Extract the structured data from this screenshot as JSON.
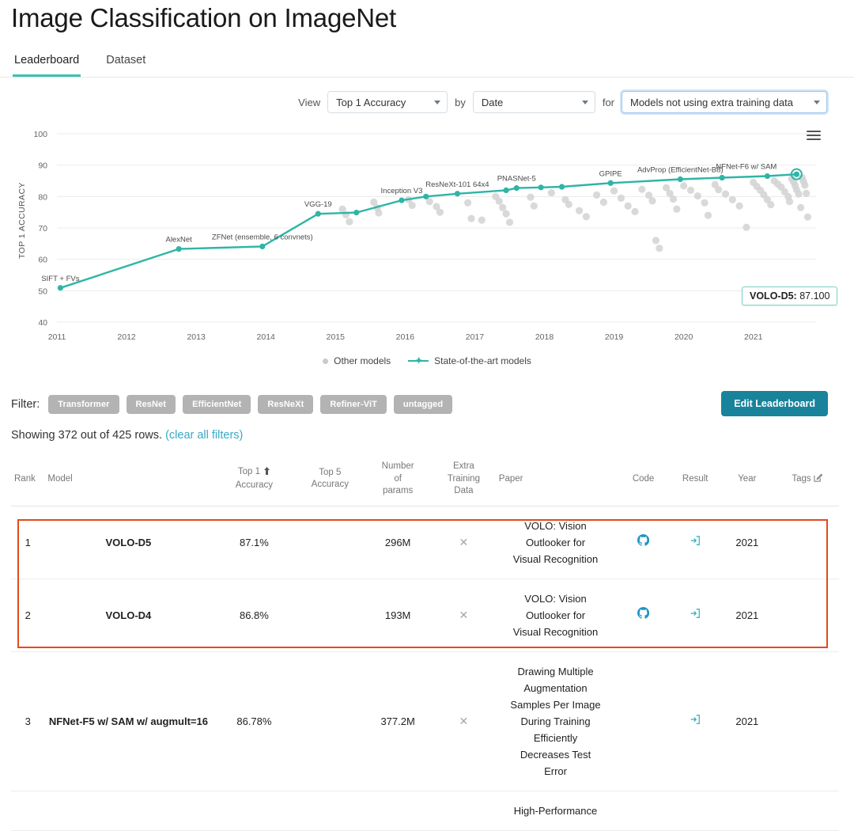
{
  "header": {
    "title": "Image Classification on ImageNet"
  },
  "tabs": [
    {
      "label": "Leaderboard",
      "active": true
    },
    {
      "label": "Dataset",
      "active": false
    }
  ],
  "controls": {
    "view_label": "View",
    "by_label": "by",
    "for_label": "for",
    "metric": "Top 1 Accuracy",
    "sort": "Date",
    "subset": "Models not using extra training data"
  },
  "chart_tooltip": {
    "model": "VOLO-D5:",
    "value": " 87.100"
  },
  "chart_menu_icon": "hamburger-menu-icon",
  "chart_data": {
    "type": "scatter",
    "title": "",
    "xlabel": "",
    "ylabel": "TOP 1 ACCURACY",
    "xlim": [
      2011,
      2021.9
    ],
    "ylim": [
      40,
      100
    ],
    "ytick_values": [
      40,
      50,
      60,
      70,
      80,
      90,
      100
    ],
    "xtick_values": [
      2011,
      2012,
      2013,
      2014,
      2015,
      2016,
      2017,
      2018,
      2019,
      2020,
      2021
    ],
    "grid": true,
    "legend": [
      {
        "label": "Other models",
        "color": "#c9c9c9"
      },
      {
        "label": "State-of-the-art models",
        "color": "#2eb5a6"
      }
    ],
    "series": [
      {
        "name": "State-of-the-art models",
        "color": "#2eb5a6",
        "points": [
          {
            "x": 2011.05,
            "y": 50.9,
            "label": "SIFT + FVs"
          },
          {
            "x": 2012.75,
            "y": 63.3,
            "label": "AlexNet"
          },
          {
            "x": 2013.95,
            "y": 64.1,
            "label": "ZFNet (ensemble, 6 convnets)"
          },
          {
            "x": 2014.75,
            "y": 74.5,
            "label": "VGG-19"
          },
          {
            "x": 2015.3,
            "y": 74.9,
            "label": ""
          },
          {
            "x": 2015.95,
            "y": 78.8,
            "label": "Inception V3"
          },
          {
            "x": 2016.3,
            "y": 80.0,
            "label": ""
          },
          {
            "x": 2016.75,
            "y": 80.9,
            "label": "ResNeXt-101 64x4"
          },
          {
            "x": 2017.45,
            "y": 82.0,
            "label": ""
          },
          {
            "x": 2017.6,
            "y": 82.7,
            "label": "PNASNet-5"
          },
          {
            "x": 2017.95,
            "y": 82.9,
            "label": ""
          },
          {
            "x": 2018.25,
            "y": 83.1,
            "label": ""
          },
          {
            "x": 2018.95,
            "y": 84.3,
            "label": "GPIPE"
          },
          {
            "x": 2019.95,
            "y": 85.5,
            "label": "AdvProp (EfficientNet-B8)"
          },
          {
            "x": 2020.55,
            "y": 86.0,
            "label": ""
          },
          {
            "x": 2021.2,
            "y": 86.5,
            "label": "NFNet-F6 w/ SAM"
          },
          {
            "x": 2021.62,
            "y": 87.1,
            "label": ""
          }
        ]
      },
      {
        "name": "Other models",
        "color": "#d2d2d2",
        "points": [
          {
            "x": 2015.1,
            "y": 76.0
          },
          {
            "x": 2015.15,
            "y": 74.2
          },
          {
            "x": 2015.2,
            "y": 72.0
          },
          {
            "x": 2015.55,
            "y": 78.2
          },
          {
            "x": 2015.6,
            "y": 76.4
          },
          {
            "x": 2015.62,
            "y": 74.8
          },
          {
            "x": 2016.05,
            "y": 79.0
          },
          {
            "x": 2016.1,
            "y": 77.2
          },
          {
            "x": 2016.35,
            "y": 78.4
          },
          {
            "x": 2016.45,
            "y": 76.8
          },
          {
            "x": 2016.5,
            "y": 75.0
          },
          {
            "x": 2016.9,
            "y": 78.0
          },
          {
            "x": 2016.95,
            "y": 73.0
          },
          {
            "x": 2017.1,
            "y": 72.5
          },
          {
            "x": 2017.3,
            "y": 80.0
          },
          {
            "x": 2017.35,
            "y": 78.5
          },
          {
            "x": 2017.4,
            "y": 76.5
          },
          {
            "x": 2017.45,
            "y": 74.5
          },
          {
            "x": 2017.5,
            "y": 71.8
          },
          {
            "x": 2017.8,
            "y": 79.8
          },
          {
            "x": 2017.85,
            "y": 77.0
          },
          {
            "x": 2018.1,
            "y": 81.2
          },
          {
            "x": 2018.3,
            "y": 79.0
          },
          {
            "x": 2018.35,
            "y": 77.5
          },
          {
            "x": 2018.5,
            "y": 75.5
          },
          {
            "x": 2018.6,
            "y": 73.6
          },
          {
            "x": 2018.75,
            "y": 80.5
          },
          {
            "x": 2018.85,
            "y": 78.2
          },
          {
            "x": 2019.0,
            "y": 81.8
          },
          {
            "x": 2019.1,
            "y": 79.5
          },
          {
            "x": 2019.2,
            "y": 77.0
          },
          {
            "x": 2019.3,
            "y": 75.2
          },
          {
            "x": 2019.4,
            "y": 82.3
          },
          {
            "x": 2019.5,
            "y": 80.4
          },
          {
            "x": 2019.55,
            "y": 78.6
          },
          {
            "x": 2019.6,
            "y": 66.0
          },
          {
            "x": 2019.65,
            "y": 63.5
          },
          {
            "x": 2019.75,
            "y": 82.8
          },
          {
            "x": 2019.8,
            "y": 81.0
          },
          {
            "x": 2019.85,
            "y": 79.2
          },
          {
            "x": 2019.9,
            "y": 76.0
          },
          {
            "x": 2020.0,
            "y": 83.4
          },
          {
            "x": 2020.1,
            "y": 82.0
          },
          {
            "x": 2020.2,
            "y": 80.2
          },
          {
            "x": 2020.3,
            "y": 78.0
          },
          {
            "x": 2020.35,
            "y": 74.0
          },
          {
            "x": 2020.45,
            "y": 83.8
          },
          {
            "x": 2020.5,
            "y": 82.2
          },
          {
            "x": 2020.6,
            "y": 80.8
          },
          {
            "x": 2020.7,
            "y": 79.0
          },
          {
            "x": 2020.8,
            "y": 77.0
          },
          {
            "x": 2020.9,
            "y": 70.2
          },
          {
            "x": 2021.0,
            "y": 84.5
          },
          {
            "x": 2021.05,
            "y": 83.2
          },
          {
            "x": 2021.1,
            "y": 82.0
          },
          {
            "x": 2021.15,
            "y": 80.6
          },
          {
            "x": 2021.2,
            "y": 79.0
          },
          {
            "x": 2021.25,
            "y": 77.4
          },
          {
            "x": 2021.3,
            "y": 85.0
          },
          {
            "x": 2021.35,
            "y": 84.0
          },
          {
            "x": 2021.4,
            "y": 83.0
          },
          {
            "x": 2021.45,
            "y": 81.5
          },
          {
            "x": 2021.5,
            "y": 80.0
          },
          {
            "x": 2021.52,
            "y": 78.4
          },
          {
            "x": 2021.55,
            "y": 85.6
          },
          {
            "x": 2021.58,
            "y": 84.6
          },
          {
            "x": 2021.6,
            "y": 83.5
          },
          {
            "x": 2021.62,
            "y": 82.2
          },
          {
            "x": 2021.65,
            "y": 80.8
          },
          {
            "x": 2021.68,
            "y": 76.5
          },
          {
            "x": 2021.7,
            "y": 86.0
          },
          {
            "x": 2021.72,
            "y": 84.8
          },
          {
            "x": 2021.74,
            "y": 83.6
          },
          {
            "x": 2021.76,
            "y": 81.0
          },
          {
            "x": 2021.78,
            "y": 73.5
          }
        ]
      }
    ]
  },
  "filters": {
    "label": "Filter:",
    "chips": [
      "Transformer",
      "ResNet",
      "EfficientNet",
      "ResNeXt",
      "Refiner-ViT",
      "untagged"
    ],
    "edit_button": "Edit Leaderboard"
  },
  "showing": {
    "text": "Showing 372 out of 425 rows.",
    "clear_link": "(clear all filters)"
  },
  "table": {
    "headers": {
      "rank": "Rank",
      "model": "Model",
      "top1": "Top 1\nAccuracy",
      "top1_line1": "Top 1",
      "top1_line2": "Accuracy",
      "top5_line1": "Top 5",
      "top5_line2": "Accuracy",
      "params_line1": "Number",
      "params_line2": "of",
      "params_line3": "params",
      "extra_line1": "Extra",
      "extra_line2": "Training",
      "extra_line3": "Data",
      "paper": "Paper",
      "code": "Code",
      "result": "Result",
      "year": "Year",
      "tags": "Tags"
    },
    "rows": [
      {
        "rank": "1",
        "model": "VOLO-D5",
        "top1": "87.1%",
        "top5": "",
        "params": "296M",
        "extra": "✕",
        "paper": [
          "VOLO: Vision",
          "Outlooker for",
          "Visual Recognition"
        ],
        "code": "github-icon",
        "result": "result-icon",
        "year": "2021",
        "tags": ""
      },
      {
        "rank": "2",
        "model": "VOLO-D4",
        "top1": "86.8%",
        "top5": "",
        "params": "193M",
        "extra": "✕",
        "paper": [
          "VOLO: Vision",
          "Outlooker for",
          "Visual Recognition"
        ],
        "code": "github-icon",
        "result": "result-icon",
        "year": "2021",
        "tags": ""
      },
      {
        "rank": "3",
        "model": "NFNet-F5 w/ SAM w/ augmult=16",
        "top1": "86.78%",
        "top5": "",
        "params": "377.2M",
        "extra": "✕",
        "paper": [
          "Drawing Multiple",
          "Augmentation",
          "Samples Per Image",
          "During Training",
          "Efficiently",
          "Decreases Test",
          "Error"
        ],
        "code": "",
        "result": "result-icon",
        "year": "2021",
        "tags": ""
      },
      {
        "rank": "",
        "model": "",
        "top1": "",
        "top5": "",
        "params": "",
        "extra": "",
        "paper": [
          "High-Performance"
        ],
        "code": "",
        "result": "",
        "year": "",
        "tags": ""
      }
    ]
  }
}
